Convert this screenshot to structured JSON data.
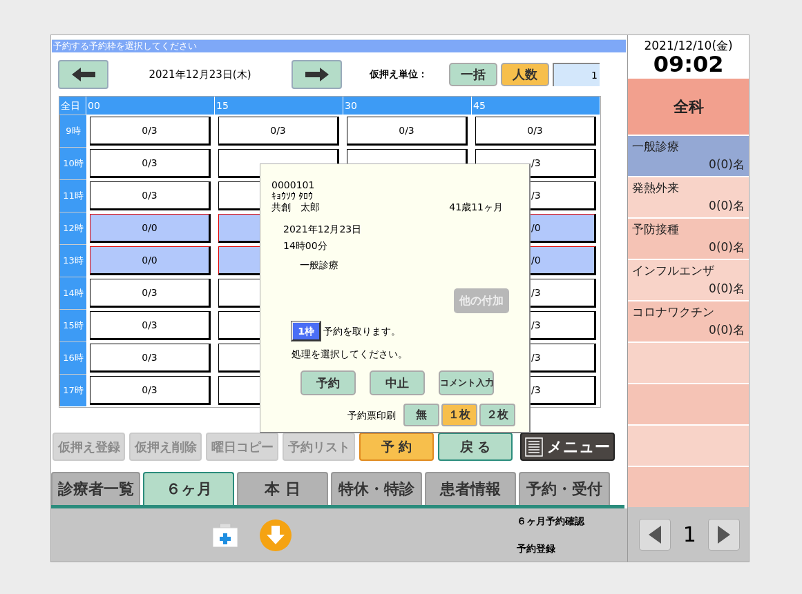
{
  "title_bar": "予約する予約枠を選択してください",
  "nav": {
    "date": "2021年12月23日(木)",
    "unit_label": "仮押え単位：",
    "unit_options": [
      {
        "label": "一括",
        "selected": false
      },
      {
        "label": "人数",
        "selected": true
      }
    ],
    "count_value": "1"
  },
  "grid": {
    "corner": "全日",
    "columns": [
      "00",
      "15",
      "30",
      "45"
    ],
    "rows": [
      {
        "hour": "9時",
        "cells": [
          {
            "text": "0/3",
            "blocked": false
          },
          {
            "text": "0/3",
            "blocked": false
          },
          {
            "text": "0/3",
            "blocked": false
          },
          {
            "text": "0/3",
            "blocked": false
          }
        ]
      },
      {
        "hour": "10時",
        "cells": [
          {
            "text": "0/3",
            "blocked": false
          },
          {
            "blocked": false
          },
          {
            "blocked": false
          },
          {
            "text": "/3",
            "blocked": false,
            "partial": true
          }
        ]
      },
      {
        "hour": "11時",
        "cells": [
          {
            "text": "0/3",
            "blocked": false
          },
          {
            "blocked": false
          },
          {},
          {
            "text": "/3",
            "blocked": false,
            "partial": true
          }
        ]
      },
      {
        "hour": "12時",
        "cells": [
          {
            "text": "0/0",
            "blocked": true
          },
          {
            "blocked": true
          },
          {},
          {
            "text": "/0",
            "blocked": true,
            "partial": true
          }
        ]
      },
      {
        "hour": "13時",
        "cells": [
          {
            "text": "0/0",
            "blocked": true
          },
          {
            "blocked": true
          },
          {},
          {
            "text": "/0",
            "blocked": true,
            "partial": true
          }
        ]
      },
      {
        "hour": "14時",
        "cells": [
          {
            "text": "0/3",
            "blocked": false
          },
          {
            "blocked": false
          },
          {},
          {
            "text": "/3",
            "blocked": false,
            "partial": true
          }
        ]
      },
      {
        "hour": "15時",
        "cells": [
          {
            "text": "0/3",
            "blocked": false
          },
          {
            "blocked": false
          },
          {},
          {
            "text": "/3",
            "blocked": false,
            "partial": true
          }
        ]
      },
      {
        "hour": "16時",
        "cells": [
          {
            "text": "0/3",
            "blocked": false
          },
          {
            "blocked": false
          },
          {},
          {
            "text": "/3",
            "blocked": false,
            "partial": true
          }
        ]
      },
      {
        "hour": "17時",
        "cells": [
          {
            "text": "0/3",
            "blocked": false
          },
          {
            "blocked": false
          },
          {},
          {
            "text": "/3",
            "blocked": false,
            "partial": true
          }
        ]
      }
    ]
  },
  "actions": [
    {
      "label": "仮押え登録",
      "kind": "disabled"
    },
    {
      "label": "仮押え削除",
      "kind": "disabled"
    },
    {
      "label": "曜日コピー",
      "kind": "disabled"
    },
    {
      "label": "予約リスト",
      "kind": "disabled"
    },
    {
      "label": "予 約",
      "kind": "primary"
    },
    {
      "label": "戻 る",
      "kind": "secondary"
    },
    {
      "label": "メニュー",
      "kind": "menu"
    }
  ],
  "tabs": [
    {
      "label": "診療者一覧",
      "selected": false
    },
    {
      "label": "６ヶ月",
      "selected": true
    },
    {
      "label": "本 日",
      "selected": false
    },
    {
      "label": "特休・特診",
      "selected": false
    },
    {
      "label": "患者情報",
      "selected": false
    },
    {
      "label": "予約・受付",
      "selected": false
    }
  ],
  "footer": {
    "hints": [
      "６ヶ月予約確認",
      "予約登録"
    ]
  },
  "clock": {
    "date": "2021/12/10(金)",
    "time": "09:02"
  },
  "department": "全科",
  "categories": [
    {
      "name": "一般診療",
      "count": "0(0)名",
      "selected": true
    },
    {
      "name": "発熱外来",
      "count": "0(0)名",
      "selected": false
    },
    {
      "name": "予防接種",
      "count": "0(0)名",
      "selected": false
    },
    {
      "name": "インフルエンザ",
      "count": "0(0)名",
      "selected": false
    },
    {
      "name": "コロナワクチン",
      "count": "0(0)名",
      "selected": false
    }
  ],
  "pager": {
    "page": "1"
  },
  "dialog": {
    "patient_id": "0000101",
    "kana": "ｷｮｳｿｳ ﾀﾛｳ",
    "name": "共創　太郎",
    "age": "41歳11ヶ月",
    "date": "2021年12月23日",
    "time": "14時00分",
    "department": "一般診療",
    "extra_button": {
      "label": "他の付加",
      "disabled": true
    },
    "slot_badge": "1枠",
    "slot_text": "予約を取ります。",
    "prompt": "処理を選択してください。",
    "buttons": [
      "予約",
      "中止",
      "コメント入力"
    ],
    "print": {
      "label": "予約票印刷",
      "options": [
        {
          "label": "無",
          "selected": false
        },
        {
          "label": "１枚",
          "selected": true
        },
        {
          "label": "２枚",
          "selected": false
        }
      ]
    }
  }
}
